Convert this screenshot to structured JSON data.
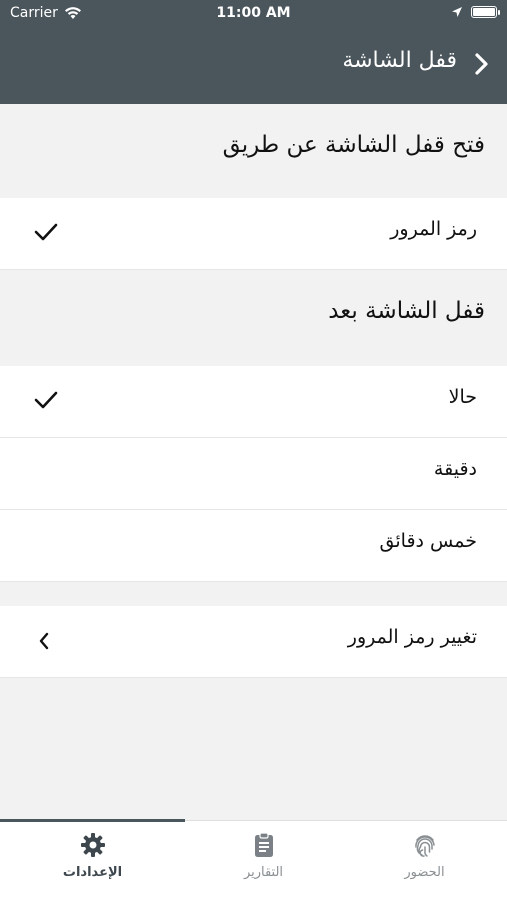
{
  "status": {
    "carrier": "Carrier",
    "time": "11:00 AM"
  },
  "nav": {
    "title": "قفل الشاشة"
  },
  "sections": {
    "unlock_header": "فتح قفل الشاشة عن طريق",
    "lock_after_header": "قفل الشاشة بعد"
  },
  "rows": {
    "passcode": "رمز المرور",
    "immediately": "حالا",
    "one_minute": "دقيقة",
    "five_minutes": "خمس دقائق",
    "change_passcode": "تغيير رمز المرور"
  },
  "tabs": {
    "settings": "الإعدادات",
    "reports": "التقارير",
    "attendance": "الحضور"
  },
  "colors": {
    "header_bg": "#4a555c",
    "active_tab": "#3d474d",
    "inactive_tab": "#8a8f93"
  }
}
